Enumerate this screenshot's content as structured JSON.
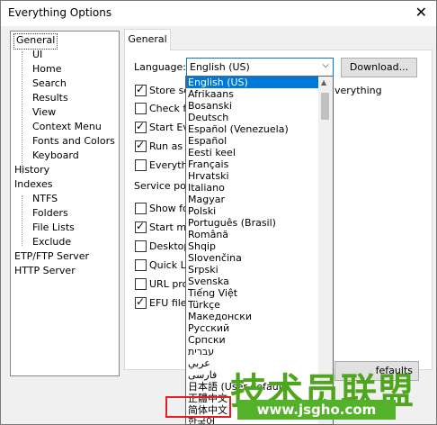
{
  "window": {
    "title": "Everything Options",
    "close_glyph": "✕"
  },
  "tree": {
    "items": [
      "General",
      "UI",
      "Home",
      "Search",
      "Results",
      "View",
      "Context Menu",
      "Fonts and Colors",
      "Keyboard",
      "History",
      "Indexes",
      "NTFS",
      "Folders",
      "File Lists",
      "Exclude",
      "ETP/FTP Server",
      "HTTP Server"
    ]
  },
  "tab": {
    "label": "General"
  },
  "general": {
    "language_label": "Language:",
    "language_value": "English (US)",
    "download_button": "Download...",
    "options": [
      "Store se",
      "Check fo",
      "Start Eve",
      "Run as a",
      "Everythin"
    ],
    "trailing_text": "verything",
    "service_port_label": "Service port",
    "options2": [
      "Show fol",
      "Start me",
      "Desktop",
      "Quick La",
      "URL prot",
      "EFU file a"
    ],
    "restore_button": "fefaults"
  },
  "dropdown": {
    "options": [
      "English (US)",
      "Afrikaans",
      "Bosanski",
      "Deutsch",
      "Español (Venezuela)",
      "Español",
      "Eesti keel",
      "Français",
      "Hrvatski",
      "Italiano",
      "Magyar",
      "Polski",
      "Português (Brasil)",
      "Română",
      "Shqip",
      "Slovenčina",
      "Srpski",
      "Svenska",
      "Tiếng Việt",
      "Türkçe",
      "Македонски",
      "Русский",
      "Српски",
      "עברית",
      "عربي",
      "فارسی",
      "日本語 (User default)",
      "正體中文",
      "简体中文",
      "한국어"
    ],
    "selected_index": 0
  },
  "watermark": {
    "brand": "技术员联盟",
    "url": "www.jsgho.com"
  },
  "colors": {
    "accent": "#0078d7",
    "highlight_box": "#e31e24",
    "watermark_green": "#4fa51d"
  }
}
